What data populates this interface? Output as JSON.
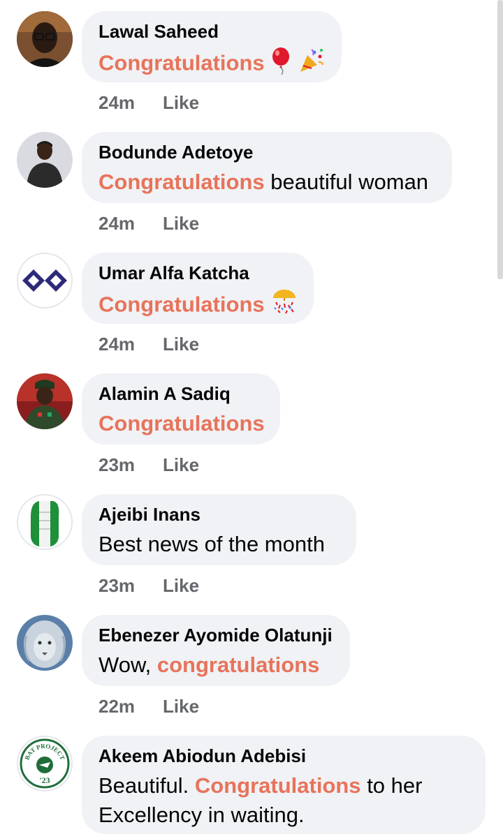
{
  "comments": [
    {
      "author": "Lawal Saheed",
      "highlight": "Congratulations",
      "time": "24m",
      "like": "Like",
      "emoji": [
        "balloon-icon",
        "party-popper-icon"
      ]
    },
    {
      "author": "Bodunde Adetoye",
      "highlight": "Congratulations",
      "rest": "beautiful woman",
      "time": "24m",
      "like": "Like"
    },
    {
      "author": "Umar Alfa Katcha",
      "highlight": "Congratulations",
      "time": "24m",
      "like": "Like",
      "emoji": [
        "confetti-ball-icon"
      ]
    },
    {
      "author": "Alamin A Sadiq",
      "highlight": "Congratulations",
      "time": "23m",
      "like": "Like"
    },
    {
      "author": "Ajeibi Inans",
      "text": "Best news of the month",
      "time": "23m",
      "like": "Like"
    },
    {
      "author": "Ebenezer Ayomide Olatunji",
      "prefix": "Wow,",
      "highlight": "congratulations",
      "time": "22m",
      "like": "Like"
    },
    {
      "author": "Akeem Abiodun Adebisi",
      "prefix": "Beautiful.",
      "highlight": "Congratulations",
      "rest": "to her Excellency in waiting."
    }
  ],
  "avatar_logos": {
    "bat_project_ring": "BAT PROJECT",
    "bat_project_year": "'23"
  },
  "colors": {
    "highlight": "#e8735a",
    "bubble": "#f0f2f5",
    "meta": "#65676b"
  }
}
